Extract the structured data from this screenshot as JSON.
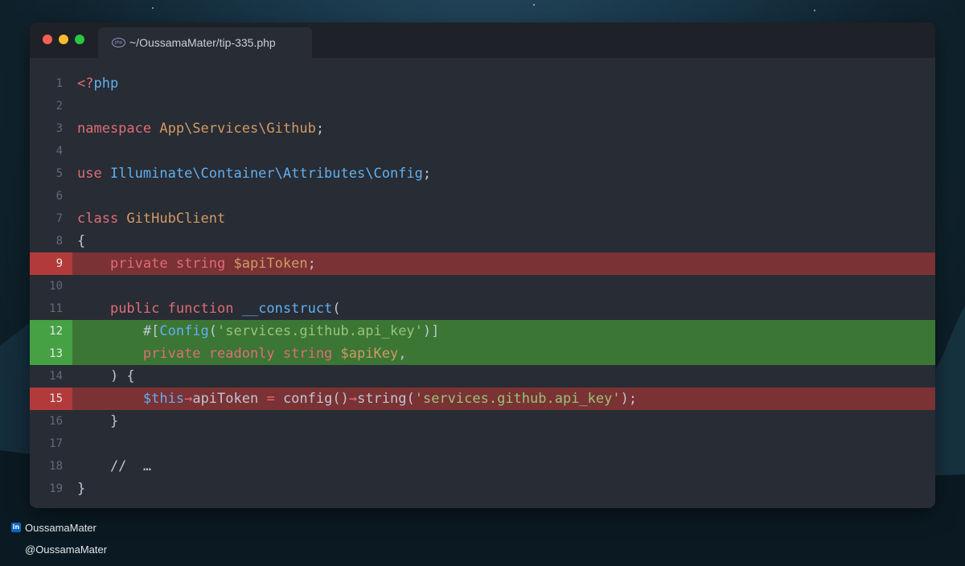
{
  "window": {
    "tab_title": "~/OussamaMater/tip-335.php",
    "file_icon": "php-icon",
    "file_icon_text": "php",
    "traffic_lights": [
      {
        "name": "close",
        "color": "#ff5f57"
      },
      {
        "name": "minimize",
        "color": "#febc2e"
      },
      {
        "name": "maximize",
        "color": "#28c840"
      }
    ]
  },
  "theme": {
    "keyword": "#e06c75",
    "type": "#d19a66",
    "entity": "#61afef",
    "string": "#98c379",
    "variable": "#d19a66",
    "text": "#bfc6d3",
    "added_bg": "#3b7634",
    "removed_bg": "#7a3234"
  },
  "code": {
    "lines": [
      {
        "num": "1",
        "state": "normal",
        "tokens": [
          {
            "t": "<?",
            "c": "keyword"
          },
          {
            "t": "php",
            "c": "entity"
          }
        ]
      },
      {
        "num": "2",
        "state": "normal",
        "tokens": []
      },
      {
        "num": "3",
        "state": "normal",
        "tokens": [
          {
            "t": "namespace ",
            "c": "keyword"
          },
          {
            "t": "App\\Services\\Github",
            "c": "type"
          },
          {
            "t": ";",
            "c": "text"
          }
        ]
      },
      {
        "num": "4",
        "state": "normal",
        "tokens": []
      },
      {
        "num": "5",
        "state": "normal",
        "tokens": [
          {
            "t": "use ",
            "c": "keyword"
          },
          {
            "t": "Illuminate\\Container\\Attributes\\Config",
            "c": "entity"
          },
          {
            "t": ";",
            "c": "text"
          }
        ]
      },
      {
        "num": "6",
        "state": "normal",
        "tokens": []
      },
      {
        "num": "7",
        "state": "normal",
        "tokens": [
          {
            "t": "class ",
            "c": "keyword"
          },
          {
            "t": "GitHubClient",
            "c": "type"
          }
        ]
      },
      {
        "num": "8",
        "state": "normal",
        "tokens": [
          {
            "t": "{",
            "c": "text"
          }
        ]
      },
      {
        "num": "9",
        "state": "removed",
        "tokens": [
          {
            "t": "    ",
            "c": "text"
          },
          {
            "t": "private string ",
            "c": "keyword"
          },
          {
            "t": "$apiToken",
            "c": "variable"
          },
          {
            "t": ";",
            "c": "text"
          }
        ]
      },
      {
        "num": "10",
        "state": "normal",
        "tokens": []
      },
      {
        "num": "11",
        "state": "normal",
        "tokens": [
          {
            "t": "    ",
            "c": "text"
          },
          {
            "t": "public function ",
            "c": "keyword"
          },
          {
            "t": "__construct",
            "c": "entity"
          },
          {
            "t": "(",
            "c": "text"
          }
        ]
      },
      {
        "num": "12",
        "state": "added",
        "tokens": [
          {
            "t": "        #[",
            "c": "text"
          },
          {
            "t": "Config",
            "c": "entity"
          },
          {
            "t": "(",
            "c": "text"
          },
          {
            "t": "'services.github.api_key'",
            "c": "string"
          },
          {
            "t": ")]",
            "c": "text"
          }
        ]
      },
      {
        "num": "13",
        "state": "added",
        "tokens": [
          {
            "t": "        ",
            "c": "text"
          },
          {
            "t": "private readonly string ",
            "c": "keyword"
          },
          {
            "t": "$apiKey",
            "c": "variable"
          },
          {
            "t": ",",
            "c": "text"
          }
        ]
      },
      {
        "num": "14",
        "state": "normal",
        "tokens": [
          {
            "t": "    ) {",
            "c": "text"
          }
        ]
      },
      {
        "num": "15",
        "state": "removed",
        "tokens": [
          {
            "t": "        ",
            "c": "text"
          },
          {
            "t": "$this",
            "c": "entity"
          },
          {
            "t": "→",
            "c": "keyword"
          },
          {
            "t": "apiToken ",
            "c": "text"
          },
          {
            "t": "= ",
            "c": "keyword"
          },
          {
            "t": "config()",
            "c": "text"
          },
          {
            "t": "→",
            "c": "keyword"
          },
          {
            "t": "string(",
            "c": "text"
          },
          {
            "t": "'services.github.api_key'",
            "c": "string"
          },
          {
            "t": ");",
            "c": "text"
          }
        ]
      },
      {
        "num": "16",
        "state": "normal",
        "tokens": [
          {
            "t": "    }",
            "c": "text"
          }
        ]
      },
      {
        "num": "17",
        "state": "normal",
        "tokens": []
      },
      {
        "num": "18",
        "state": "normal",
        "tokens": [
          {
            "t": "    //  …",
            "c": "text"
          }
        ]
      },
      {
        "num": "19",
        "state": "normal",
        "tokens": [
          {
            "t": "}",
            "c": "text"
          }
        ]
      }
    ]
  },
  "footer": {
    "linkedin_icon": "linkedin-icon",
    "linkedin_icon_text": "in",
    "linkedin_handle": "OussamaMater",
    "twitter_handle": "@OussamaMater"
  }
}
